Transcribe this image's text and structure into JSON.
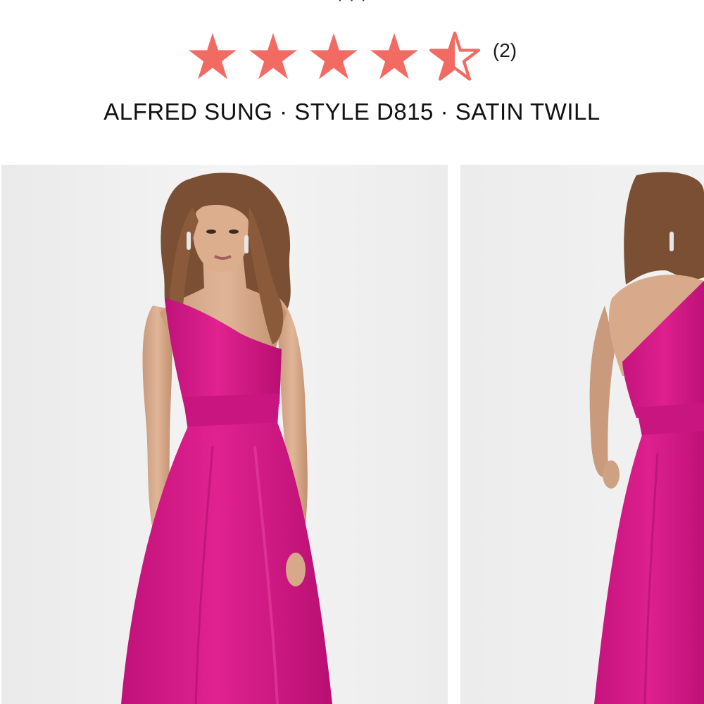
{
  "header": {
    "rating_value": 4.5,
    "rating_max": 5,
    "review_count": "(2)",
    "product_meta": "ALFRED SUNG · STYLE D815 · SATIN TWILL"
  },
  "gallery": {
    "images": [
      {
        "name": "model-front-view"
      },
      {
        "name": "model-back-view"
      }
    ]
  },
  "colors": {
    "star": "#f26b63",
    "dress": "#d41a8a",
    "background": "#efefef"
  }
}
